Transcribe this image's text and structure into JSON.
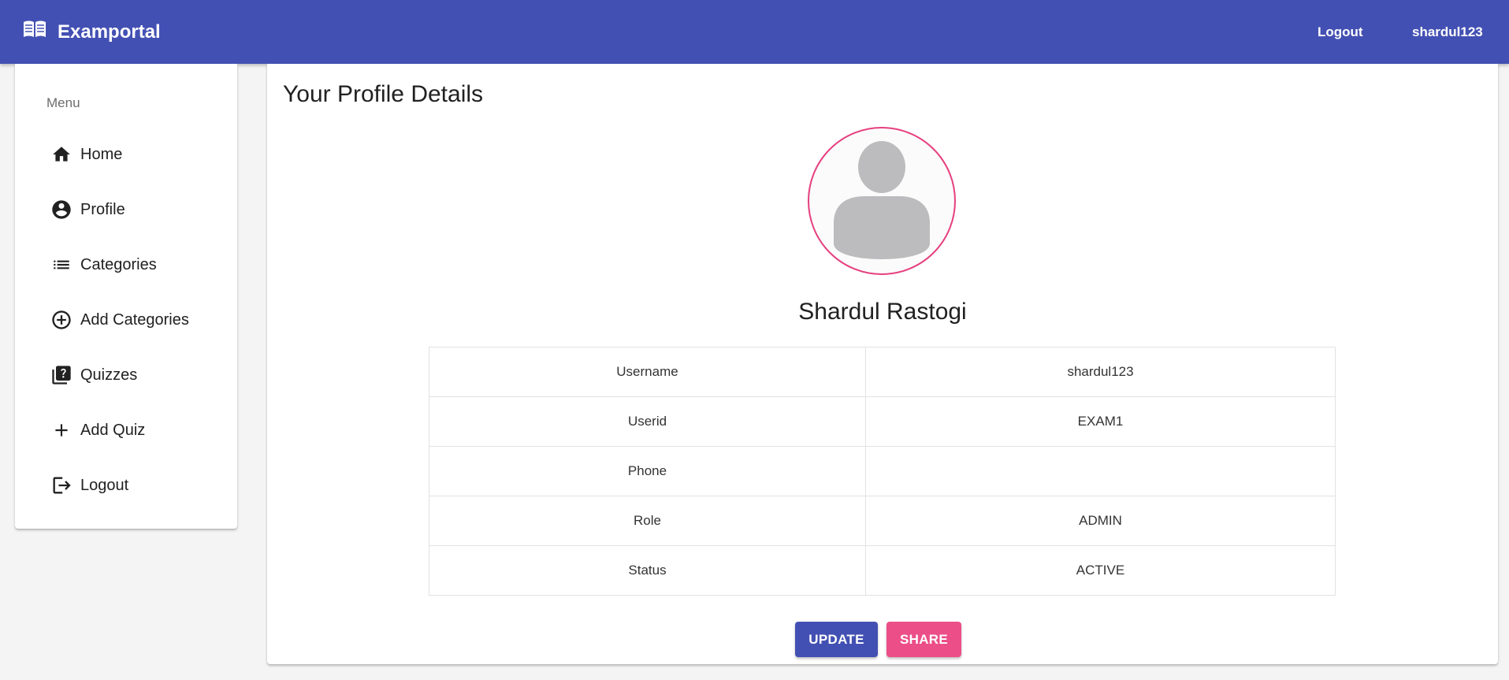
{
  "header": {
    "brand": "Examportal",
    "logout_label": "Logout",
    "username": "shardul123"
  },
  "sidebar": {
    "menu_label": "Menu",
    "items": [
      {
        "label": "Home",
        "icon": "home-icon"
      },
      {
        "label": "Profile",
        "icon": "account-circle-icon"
      },
      {
        "label": "Categories",
        "icon": "list-icon"
      },
      {
        "label": "Add Categories",
        "icon": "add-circle-icon"
      },
      {
        "label": "Quizzes",
        "icon": "quiz-icon"
      },
      {
        "label": "Add Quiz",
        "icon": "plus-icon"
      },
      {
        "label": "Logout",
        "icon": "logout-icon"
      }
    ]
  },
  "main": {
    "title": "Your Profile Details",
    "full_name": "Shardul Rastogi",
    "details": [
      {
        "key": "Username",
        "value": "shardul123"
      },
      {
        "key": "Userid",
        "value": "EXAM1"
      },
      {
        "key": "Phone",
        "value": ""
      },
      {
        "key": "Role",
        "value": "ADMIN"
      },
      {
        "key": "Status",
        "value": "ACTIVE"
      }
    ],
    "update_label": "UPDATE",
    "share_label": "SHARE"
  },
  "colors": {
    "primary": "#4350b3",
    "accent": "#ec4e87",
    "avatar_border": "#e63f7f",
    "background": "#f4f4f4"
  }
}
